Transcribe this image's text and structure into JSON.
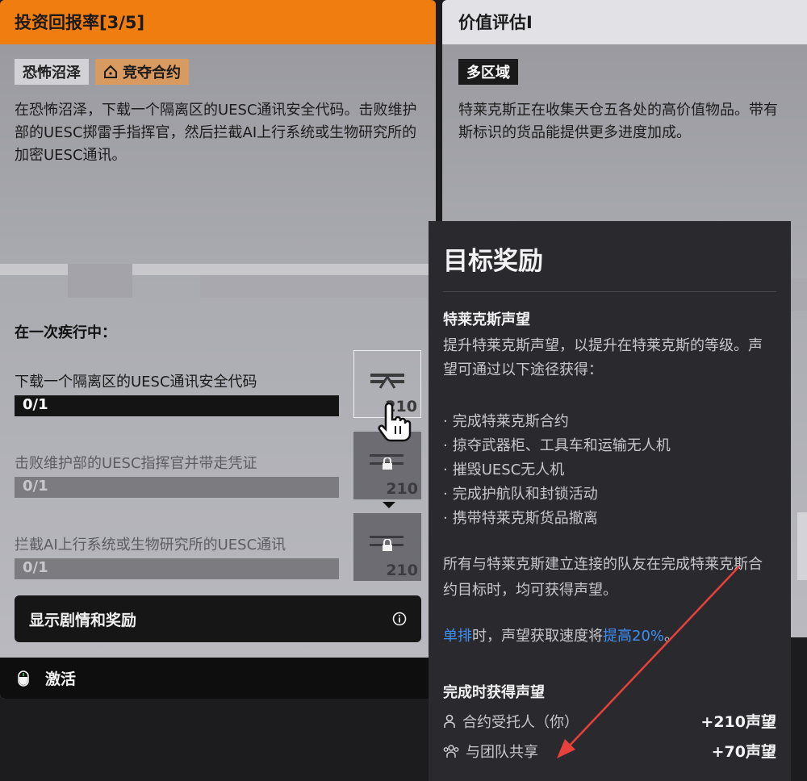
{
  "left_card": {
    "title": "投资回报率[3/5]",
    "tag_location": "恐怖沼泽",
    "tag_mode": "竞夺合约",
    "description": "在恐怖沼泽，下载一个隔离区的UESC通讯安全代码。击败维护部的UESC掷雷手指挥官，然后拦截AI上行系统或生物研究所的加密UESC通讯。",
    "section_title": "在一次疾行中：",
    "objectives": [
      {
        "label": "下载一个隔离区的UESC通讯安全代码",
        "progress": "0/1",
        "reward": "210",
        "locked": false
      },
      {
        "label": "击败维护部的UESC指挥官并带走凭证",
        "progress": "0/1",
        "reward": "210",
        "locked": true
      },
      {
        "label": "拦截AI上行系统或生物研究所的UESC通讯",
        "progress": "0/1",
        "reward": "210",
        "locked": true
      }
    ],
    "show_button": "显示剧情和奖励",
    "activate_label": "激活"
  },
  "right_card": {
    "title": "价值评估I",
    "tag": "多区域",
    "description_line1": "特莱克斯正在收集天仓五各处的高价值物品。带有",
    "description_line2": "斯标识的货品能提供更多进度加成。"
  },
  "tooltip": {
    "title": "目标奖励",
    "subtitle": "特莱克斯声望",
    "para1": "提升特莱克斯声望，以提升在特莱克斯的等级。声望可通过以下途径获得：",
    "list": [
      "完成特莱克斯合约",
      "掠夺武器柜、工具车和运输无人机",
      "摧毁UESC无人机",
      "完成护航队和封锁活动",
      "携带特莱克斯货品撤离"
    ],
    "para2": "所有与特莱克斯建立连接的队友在完成特莱克斯合约目标时，均可获得声望。",
    "solo_word": "单排",
    "para3_mid": "时，声望获取速度将",
    "boost_text": "提高20%",
    "para3_end": "。",
    "section2": "完成时获得声望",
    "rows": [
      {
        "label": "合约受托人（你）",
        "value": "+210声望",
        "icon": "person-icon"
      },
      {
        "label": "与团队共享",
        "value": "+70声望",
        "icon": "team-icon"
      }
    ]
  },
  "colors": {
    "accent_orange": "#ef7d10",
    "highlight_blue": "#3f8ef5",
    "annotation_red": "#e8403a"
  }
}
